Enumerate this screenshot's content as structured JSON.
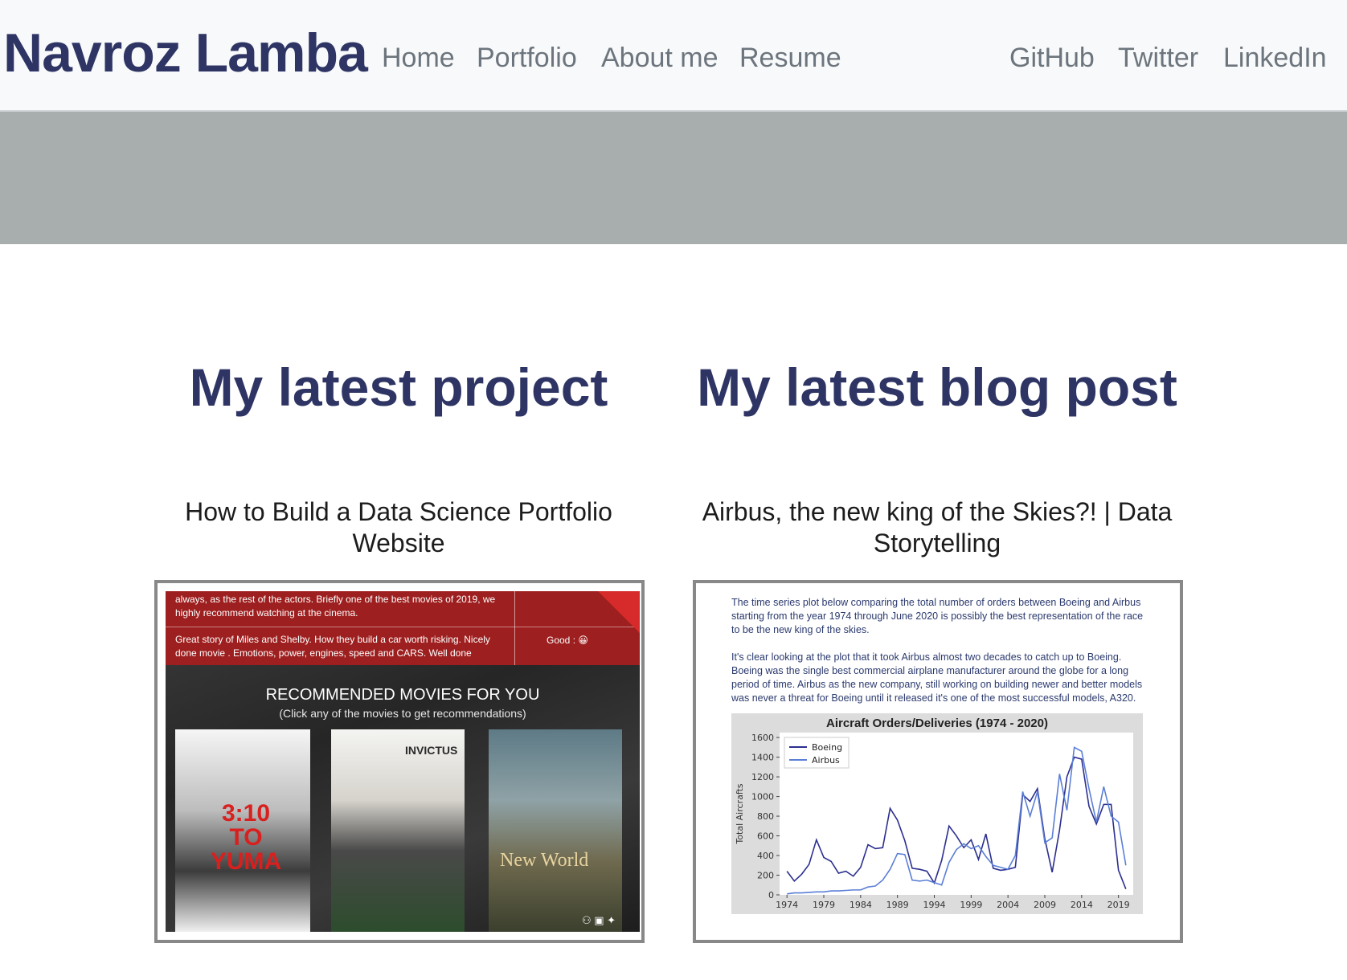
{
  "navbar": {
    "brand": "Navroz Lamba",
    "links": [
      "Home",
      "Portfolio",
      "About me",
      "Resume"
    ],
    "social": [
      "GitHub",
      "Twitter",
      "LinkedIn"
    ]
  },
  "project": {
    "heading": "My latest project",
    "title": "How to Build a Data Science Portfolio Website",
    "thumb": {
      "review1": "always, as the rest of the actors. Briefly one of the best movies of 2019, we highly recommend watching at the cinema.",
      "review2": "Great story of Miles and Shelby. How they build a car worth risking. Nicely done movie . Emotions, power, engines, speed and CARS. Well done",
      "rating": "Good : 😀",
      "rec_title": "RECOMMENDED MOVIES FOR YOU",
      "rec_sub": "(Click any of the movies to get recommendations)",
      "posters": [
        "3:10 TO YUMA",
        "INVICTUS",
        "New World"
      ]
    }
  },
  "blog": {
    "heading": "My latest blog post",
    "title": "Airbus, the new king of the Skies?! | Data Storytelling",
    "thumb": {
      "para1": "The time series plot below comparing the total number of orders between Boeing and Airbus starting from the year 1974 through June 2020 is possibly the best representation of the race to be the new king of the skies.",
      "para2": "It's clear looking at the plot that it took Airbus almost two decades to catch up to Boeing. Boeing was the single best commercial airplane manufacturer around the globe for a long period of time. Airbus as the new company, still working on building newer and better models was never a threat for Boeing until it released it's one of the most successful models, A320."
    }
  },
  "chart_data": {
    "type": "line",
    "title": "Aircraft Orders/Deliveries (1974 - 2020)",
    "xlabel": "",
    "ylabel": "Total Aircrafts",
    "xlim": [
      1973,
      2021
    ],
    "ylim": [
      0,
      1650
    ],
    "xticks": [
      1974,
      1979,
      1984,
      1989,
      1994,
      1999,
      2004,
      2009,
      2014,
      2019
    ],
    "yticks": [
      0,
      200,
      400,
      600,
      800,
      1000,
      1200,
      1400,
      1600
    ],
    "legend": "top-left",
    "x": [
      1974,
      1975,
      1976,
      1977,
      1978,
      1979,
      1980,
      1981,
      1982,
      1983,
      1984,
      1985,
      1986,
      1987,
      1988,
      1989,
      1990,
      1991,
      1992,
      1993,
      1994,
      1995,
      1996,
      1997,
      1998,
      1999,
      2000,
      2001,
      2002,
      2003,
      2004,
      2005,
      2006,
      2007,
      2008,
      2009,
      2010,
      2011,
      2012,
      2013,
      2014,
      2015,
      2016,
      2017,
      2018,
      2019,
      2020
    ],
    "series": [
      {
        "name": "Boeing",
        "color": "#2b2f8f",
        "values": [
          240,
          140,
          210,
          310,
          560,
          380,
          340,
          220,
          240,
          190,
          280,
          510,
          470,
          480,
          880,
          760,
          550,
          270,
          260,
          240,
          120,
          350,
          700,
          600,
          480,
          560,
          360,
          620,
          270,
          250,
          260,
          280,
          1020,
          950,
          1080,
          570,
          230,
          660,
          1200,
          1400,
          1380,
          900,
          720,
          920,
          920,
          250,
          60
        ]
      },
      {
        "name": "Airbus",
        "color": "#5b7fd6",
        "values": [
          10,
          20,
          20,
          25,
          30,
          30,
          40,
          40,
          45,
          50,
          50,
          80,
          90,
          150,
          260,
          420,
          410,
          150,
          140,
          150,
          125,
          100,
          330,
          460,
          520,
          470,
          500,
          390,
          300,
          280,
          260,
          400,
          1050,
          800,
          1050,
          530,
          580,
          1230,
          860,
          1500,
          1460,
          1080,
          740,
          1100,
          800,
          740,
          300
        ]
      }
    ]
  }
}
